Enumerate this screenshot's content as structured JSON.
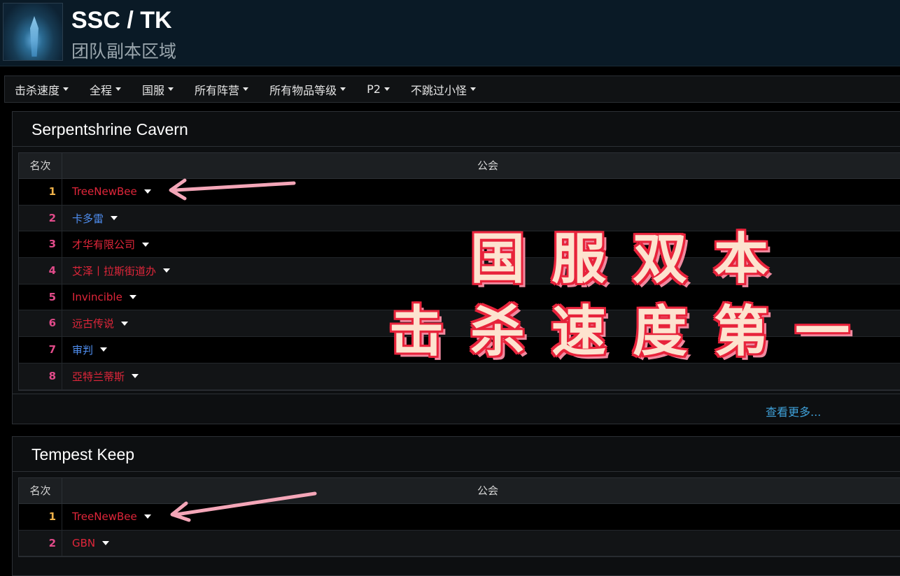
{
  "header": {
    "title": "SSC / TK",
    "subtitle": "团队副本区域"
  },
  "filters": [
    {
      "label": "击杀速度"
    },
    {
      "label": "全程"
    },
    {
      "label": "国服"
    },
    {
      "label": "所有阵营"
    },
    {
      "label": "所有物品等级"
    },
    {
      "label": "P2"
    },
    {
      "label": "不跳过小怪"
    }
  ],
  "panels": [
    {
      "title": "Serpentshrine Cavern",
      "col_rank": "名次",
      "col_guild": "公会",
      "rows": [
        {
          "rank": "1",
          "rank_color": "#f0b24a",
          "guild": "TreeNewBee",
          "guild_color": "#e0263a"
        },
        {
          "rank": "2",
          "rank_color": "#e24b8a",
          "guild": "卡多雷",
          "guild_color": "#4f8ef0"
        },
        {
          "rank": "3",
          "rank_color": "#e24b8a",
          "guild": "才华有限公司",
          "guild_color": "#e0263a"
        },
        {
          "rank": "4",
          "rank_color": "#e24b8a",
          "guild": "艾泽丨拉斯街道办",
          "guild_color": "#e0263a"
        },
        {
          "rank": "5",
          "rank_color": "#e24b8a",
          "guild": "Invincible",
          "guild_color": "#e0263a"
        },
        {
          "rank": "6",
          "rank_color": "#e24b8a",
          "guild": "远古传说",
          "guild_color": "#e0263a"
        },
        {
          "rank": "7",
          "rank_color": "#e24b8a",
          "guild": "审判",
          "guild_color": "#4f8ef0"
        },
        {
          "rank": "8",
          "rank_color": "#e24b8a",
          "guild": "亞特兰蒂斯",
          "guild_color": "#e0263a"
        }
      ],
      "view_more": "查看更多..."
    },
    {
      "title": "Tempest Keep",
      "col_rank": "名次",
      "col_guild": "公会",
      "rows": [
        {
          "rank": "1",
          "rank_color": "#f0b24a",
          "guild": "TreeNewBee",
          "guild_color": "#e0263a"
        },
        {
          "rank": "2",
          "rank_color": "#e24b8a",
          "guild": "GBN",
          "guild_color": "#e0263a"
        }
      ]
    }
  ],
  "overlay": {
    "line1": "国服双本",
    "line2": "击杀速度第一"
  },
  "colors": {
    "accent_link": "#3fa0d8",
    "horde_red": "#e0263a",
    "alliance_blue": "#4f8ef0",
    "arrow_pink": "#f4a6b8"
  }
}
